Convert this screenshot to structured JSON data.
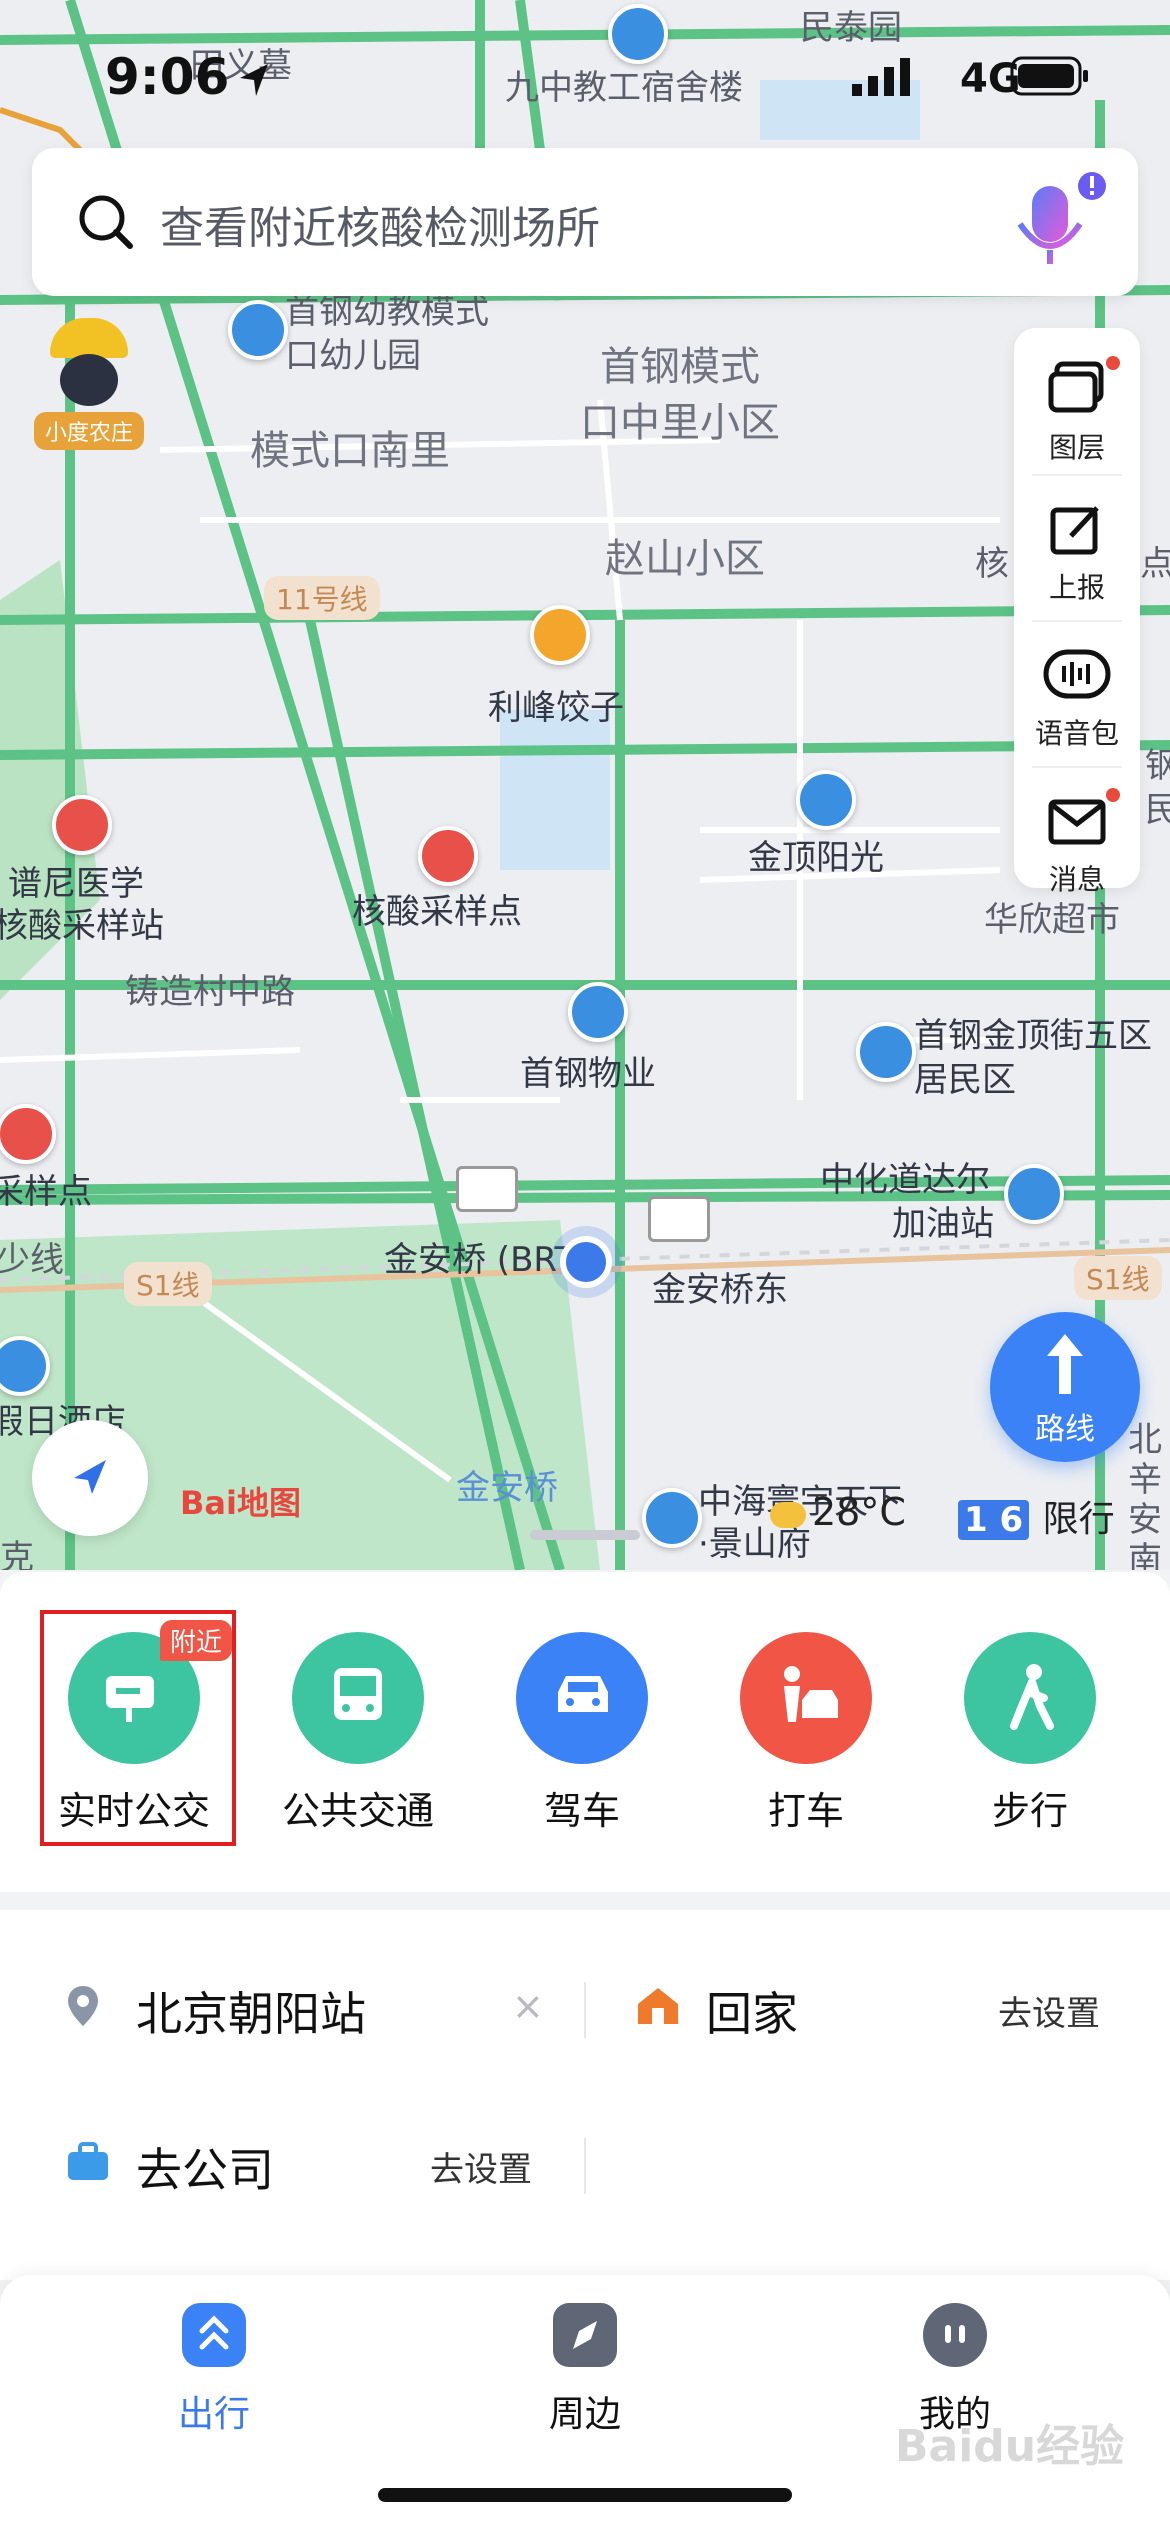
{
  "status": {
    "time": "9:06",
    "network": "4G"
  },
  "search": {
    "placeholder": "查看附近核酸检测场所"
  },
  "side_tools": [
    "图层",
    "上报",
    "语音包",
    "消息"
  ],
  "map": {
    "labels": [
      "田义墓",
      "九中教工宿舍楼",
      "民泰园",
      "首钢幼教模式",
      "口幼儿园",
      "首钢模式",
      "口中里小区",
      "模式口南里",
      "赵山小区",
      "核",
      "点",
      "11号线",
      "利峰饺子",
      "钢",
      "民",
      "金顶阳光",
      "谱尼医学",
      "核酸采样站",
      "核酸采样点",
      "华欣超市",
      "铸造村中路",
      "首钢物业",
      "首钢金顶街五区",
      "居民区",
      "采样点",
      "中化道达尔",
      "加油站",
      "金安桥 (BRT)",
      "金安桥东",
      "S1线",
      "S1线",
      "少线",
      "假日酒店",
      "金安桥",
      "中海寰宇天下",
      "·景山府",
      "北",
      "辛",
      "安",
      "南",
      "克",
      "小度农庄"
    ],
    "weather": "28°C",
    "limit_numbers": "1 6",
    "limit_text": "限行",
    "logo": "Bai地图",
    "route_label": "路线"
  },
  "transport": [
    {
      "label": "实时公交",
      "badge": "附近",
      "color": "#3cc5a0"
    },
    {
      "label": "公共交通",
      "color": "#3cc5a0"
    },
    {
      "label": "驾车",
      "color": "#3b82f6"
    },
    {
      "label": "打车",
      "color": "#f05545"
    },
    {
      "label": "步行",
      "color": "#3cc5a0"
    }
  ],
  "places": {
    "recent": "北京朝阳站",
    "home": "回家",
    "home_action": "去设置",
    "company": "去公司",
    "company_action": "去设置"
  },
  "tabs": [
    "出行",
    "周边",
    "我的"
  ],
  "watermark": "Baidu经验"
}
